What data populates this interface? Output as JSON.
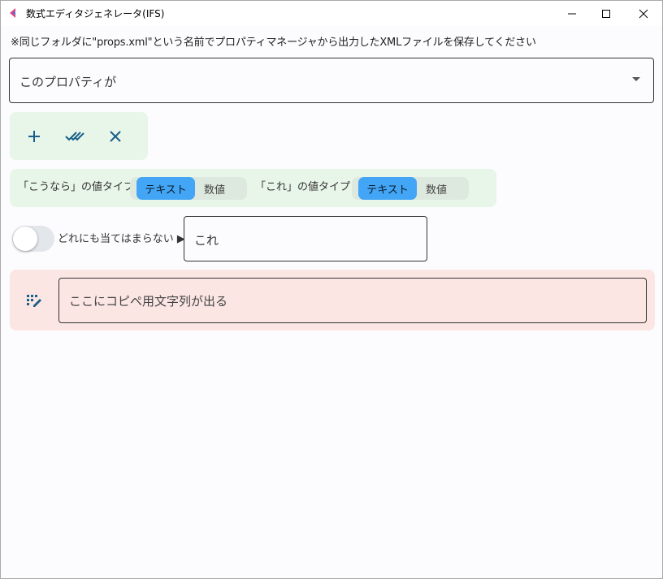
{
  "window": {
    "title": "数式エディタジェネレータ(IFS)"
  },
  "notice_text": "※同じフォルダに\"props.xml\"という名前でプロパティマネージャから出力したXMLファイルを保存してください",
  "property_select": {
    "selected": "このプロパティが"
  },
  "toolbar": {
    "add_icon": "plus-icon",
    "check_icon": "double-check-icon",
    "clear_icon": "close-icon"
  },
  "value_types": {
    "if_label": "「こうなら」の値タイプ：",
    "then_label": "「これ」の値タイプ：",
    "options": [
      "テキスト",
      "数値"
    ],
    "if_selected": "テキスト",
    "then_selected": "テキスト"
  },
  "default_row": {
    "toggle_on": false,
    "label": "どれにも当てはまらない ▶",
    "value": "これ"
  },
  "output": {
    "placeholder": "ここにコピペ用文字列が出る",
    "copy_icon": "copy-format-icon"
  },
  "colors": {
    "accent": "#42a5f5",
    "green_panel": "#e8f5e9",
    "red_panel": "#fbe6e4",
    "icon": "#1a5f8a"
  }
}
